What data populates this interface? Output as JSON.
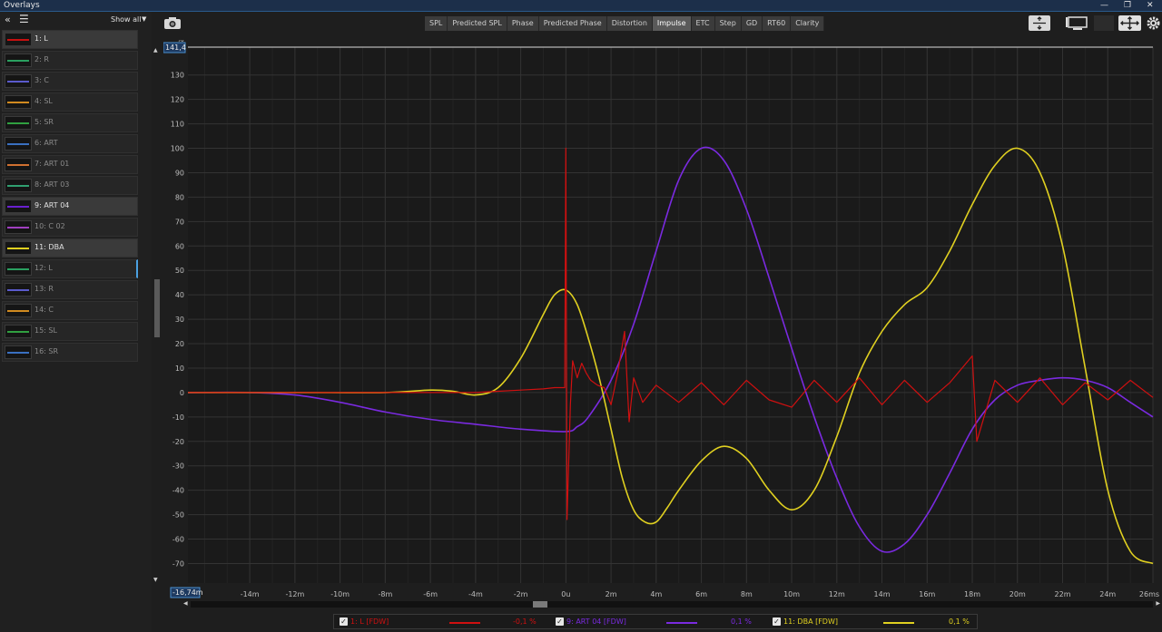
{
  "window": {
    "title": "Overlays"
  },
  "sidebar": {
    "show_all_label": "Show all",
    "items": [
      {
        "label": "1: L",
        "color": "#c81010",
        "selected": true
      },
      {
        "label": "2: R",
        "color": "#2aa060"
      },
      {
        "label": "3: C",
        "color": "#5a5acc"
      },
      {
        "label": "4: SL",
        "color": "#d08a20"
      },
      {
        "label": "5: SR",
        "color": "#30a040"
      },
      {
        "label": "6: ART",
        "color": "#3a70c0"
      },
      {
        "label": "7: ART 01",
        "color": "#d07030"
      },
      {
        "label": "8: ART 03",
        "color": "#30a070"
      },
      {
        "label": "9: ART 04",
        "color": "#6a20d0",
        "selected": true
      },
      {
        "label": "10: C 02",
        "color": "#a040c0"
      },
      {
        "label": "11: DBA",
        "color": "#e0d020",
        "selected": true
      },
      {
        "label": "12: L",
        "color": "#2aa060"
      },
      {
        "label": "13: R",
        "color": "#5a5acc"
      },
      {
        "label": "14: C",
        "color": "#d08a20"
      },
      {
        "label": "15: SL",
        "color": "#30a040"
      },
      {
        "label": "16: SR",
        "color": "#3a70c0"
      }
    ]
  },
  "toolbar": {
    "tabs": [
      "SPL",
      "Predicted SPL",
      "Phase",
      "Predicted Phase",
      "Distortion",
      "Impulse",
      "ETC",
      "Step",
      "GD",
      "RT60",
      "Clarity"
    ],
    "active_tab": "Impulse"
  },
  "chart_data": {
    "type": "line",
    "ylabel": "%",
    "y_max_readout": "141,4",
    "x_min_readout": "-16,74m",
    "xlim": [
      -16.74,
      26
    ],
    "ylim": [
      -78,
      141.4
    ],
    "x_ticks": [
      -14,
      -12,
      -10,
      -8,
      -6,
      -4,
      -2,
      0,
      2,
      4,
      6,
      8,
      10,
      12,
      14,
      16,
      18,
      20,
      22,
      24,
      26
    ],
    "x_tick_labels": [
      "-14m",
      "-12m",
      "-10m",
      "-8m",
      "-6m",
      "-4m",
      "-2m",
      "0u",
      "2m",
      "4m",
      "6m",
      "8m",
      "10m",
      "12m",
      "14m",
      "16m",
      "18m",
      "20m",
      "22m",
      "24m",
      "26ms"
    ],
    "y_ticks": [
      130,
      120,
      110,
      100,
      90,
      80,
      70,
      60,
      50,
      40,
      30,
      20,
      10,
      0,
      -10,
      -20,
      -30,
      -40,
      -50,
      -60,
      -70
    ],
    "series": [
      {
        "name": "1: L [FDW]",
        "color": "#d01010",
        "x": [
          -16.74,
          -4,
          -3,
          -2,
          -1,
          -0.5,
          -0.05,
          0,
          0.05,
          0.2,
          0.3,
          0.5,
          0.7,
          0.9,
          1.1,
          1.4,
          1.7,
          2.0,
          2.3,
          2.6,
          2.8,
          3.0,
          3.4,
          4,
          5,
          6,
          7,
          8,
          9,
          10,
          11,
          12,
          13,
          14,
          15,
          16,
          17,
          18,
          18.2,
          19,
          20,
          21,
          22,
          23,
          24,
          25,
          26
        ],
        "values": [
          0,
          0,
          0.5,
          1,
          1.5,
          2,
          2,
          100,
          -52,
          -5,
          13,
          6,
          12,
          8,
          5,
          3,
          2,
          -5,
          8,
          25,
          -12,
          6,
          -4,
          3,
          -4,
          4,
          -5,
          5,
          -3,
          -6,
          5,
          -4,
          6,
          -5,
          5,
          -4,
          4,
          15,
          -20,
          5,
          -4,
          6,
          -5,
          4,
          -3,
          5,
          -2
        ]
      },
      {
        "name": "9: ART 04 [FDW]",
        "color": "#7a2ae0",
        "x": [
          -16.74,
          -14,
          -12,
          -10,
          -8,
          -6,
          -4,
          -2,
          0,
          0.5,
          1,
          2,
          3,
          4,
          5,
          6,
          7,
          8,
          9,
          10,
          11,
          12,
          13,
          14,
          15,
          16,
          17,
          18,
          19,
          20,
          21,
          22,
          23,
          24,
          25,
          26
        ],
        "values": [
          0,
          0,
          -1,
          -4,
          -8,
          -11,
          -13,
          -15,
          -16,
          -14,
          -10,
          5,
          28,
          58,
          87,
          100,
          95,
          75,
          47,
          18,
          -10,
          -35,
          -55,
          -65,
          -62,
          -50,
          -33,
          -15,
          -3,
          3,
          5,
          6,
          5,
          2,
          -4,
          -10
        ]
      },
      {
        "name": "11: DBA [FDW]",
        "color": "#e0d020",
        "x": [
          -16.74,
          -12,
          -8,
          -6,
          -5,
          -4,
          -3,
          -2,
          -1,
          -0.5,
          0,
          0.5,
          1,
          1.5,
          2,
          2.5,
          3,
          3.5,
          4,
          4.5,
          5,
          6,
          7,
          8,
          9,
          10,
          11,
          12,
          13,
          14,
          15,
          16,
          17,
          18,
          19,
          20,
          21,
          22,
          23,
          24,
          25,
          26
        ],
        "values": [
          0,
          0,
          0,
          1,
          0.5,
          -1,
          2,
          14,
          32,
          40,
          42,
          36,
          22,
          5,
          -15,
          -35,
          -48,
          -53,
          -53,
          -47,
          -40,
          -28,
          -22,
          -27,
          -40,
          -48,
          -40,
          -18,
          8,
          25,
          36,
          43,
          58,
          77,
          93,
          100,
          90,
          60,
          10,
          -40,
          -65,
          -70
        ]
      }
    ]
  },
  "legend": {
    "entries": [
      {
        "label": "1: L [FDW]",
        "value": "-0,1 %",
        "color": "#d01010"
      },
      {
        "label": "9: ART 04 [FDW]",
        "value": "0,1 %",
        "color": "#7a2ae0"
      },
      {
        "label": "11: DBA [FDW]",
        "value": "0,1 %",
        "color": "#e0d020"
      }
    ]
  },
  "icons": [
    "expand-arrows-icon",
    "chevron-double-left-icon",
    "hamburger-menu-icon",
    "camera-icon",
    "gear-icon",
    "monitor-icon",
    "fit-arrows-icon"
  ]
}
